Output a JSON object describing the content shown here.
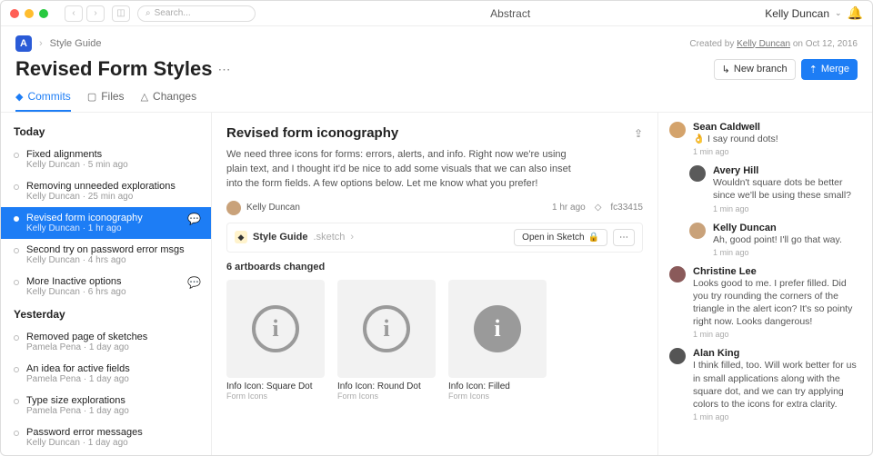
{
  "titlebar": {
    "search_placeholder": "Search...",
    "app_title": "Abstract",
    "user_name": "Kelly Duncan"
  },
  "header": {
    "breadcrumb_project": "Style Guide",
    "created_prefix": "Created by ",
    "created_user": "Kelly Duncan",
    "created_suffix": " on Oct 12, 2016",
    "page_title": "Revised Form Styles",
    "new_branch_label": "New branch",
    "merge_label": "Merge",
    "tabs": {
      "commits": "Commits",
      "files": "Files",
      "changes": "Changes"
    }
  },
  "sidebar": {
    "groups": [
      {
        "label": "Today"
      },
      {
        "label": "Yesterday"
      }
    ],
    "today": [
      {
        "title": "Fixed alignments",
        "meta": "Kelly Duncan · 5 min ago"
      },
      {
        "title": "Removing unneeded explorations",
        "meta": "Kelly Duncan · 25 min ago"
      },
      {
        "title": "Revised form iconography",
        "meta": "Kelly Duncan · 1 hr ago"
      },
      {
        "title": "Second try on password error msgs",
        "meta": "Kelly Duncan · 4 hrs ago"
      },
      {
        "title": "More Inactive options",
        "meta": "Kelly Duncan · 6 hrs ago"
      }
    ],
    "yesterday": [
      {
        "title": "Removed page of sketches",
        "meta": "Pamela Pena · 1 day ago"
      },
      {
        "title": "An idea for active fields",
        "meta": "Pamela Pena · 1 day ago"
      },
      {
        "title": "Type size explorations",
        "meta": "Pamela Pena · 1 day ago"
      },
      {
        "title": "Password error messages",
        "meta": "Kelly Duncan · 1 day ago"
      }
    ]
  },
  "main": {
    "title": "Revised form iconography",
    "description": "We need three icons for forms: errors, alerts, and info. Right now we're using plain text, and I thought it'd be nice to add some visuals that we can also inset into the form fields. A few options below. Let me know what you prefer!",
    "author": "Kelly Duncan",
    "time": "1 hr ago",
    "hash": "fc33415",
    "file_name": "Style Guide",
    "file_ext": ".sketch",
    "open_label": "Open in Sketch",
    "changed_label": "6 artboards changed",
    "artboards": [
      {
        "title": "Info Icon: Square Dot",
        "sub": "Form Icons"
      },
      {
        "title": "Info Icon: Round Dot",
        "sub": "Form Icons"
      },
      {
        "title": "Info Icon: Filled",
        "sub": "Form Icons"
      }
    ]
  },
  "comments": [
    {
      "name": "Sean Caldwell",
      "text": "👌 I say round dots!",
      "time": "1 min ago"
    },
    {
      "name": "Avery Hill",
      "text": "Wouldn't square dots be better since we'll be using these small?",
      "time": "1 min ago",
      "indent": true
    },
    {
      "name": "Kelly Duncan",
      "text": "Ah, good point! I'll go that way.",
      "time": "1 min ago",
      "indent": true
    },
    {
      "name": "Christine Lee",
      "text": "Looks good to me. I prefer filled. Did you try rounding the corners of the triangle in the alert icon? It's so pointy right now. Looks dangerous!",
      "time": "1 min ago"
    },
    {
      "name": "Alan King",
      "text": "I think filled, too. Will work better for us in small applications along with the square dot, and we can try applying colors to the icons for extra clarity.",
      "time": "1 min ago"
    }
  ]
}
